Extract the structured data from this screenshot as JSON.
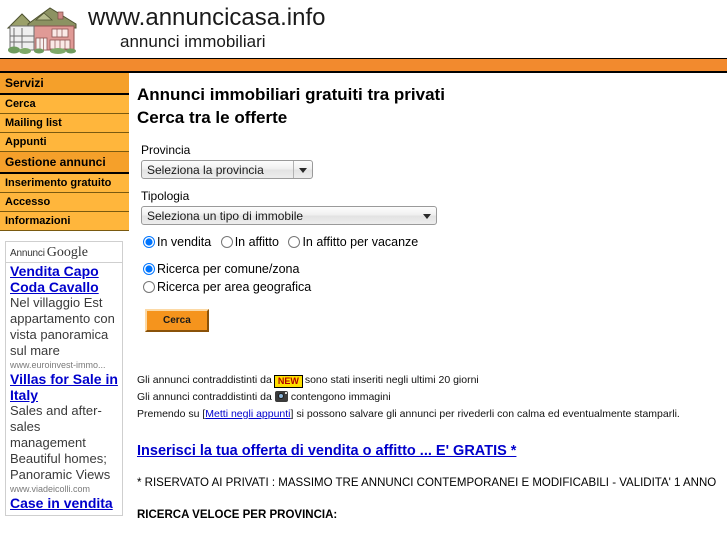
{
  "header": {
    "logo_icon": "house-logo",
    "title": "www.annuncicasa.info",
    "subtitle": "annunci immobiliari",
    "bar_color": "#f28a2e"
  },
  "sidebar": {
    "groups": [
      {
        "heading": "Servizi",
        "items": [
          {
            "label": "Cerca"
          },
          {
            "label": "Mailing list"
          },
          {
            "label": "Appunti"
          }
        ]
      },
      {
        "heading": "Gestione annunci",
        "items": [
          {
            "label": "Inserimento gratuito"
          },
          {
            "label": "Accesso"
          },
          {
            "label": "Informazioni"
          }
        ]
      }
    ],
    "ads": {
      "head_label": "Annunci",
      "head_brand": "Google",
      "units": [
        {
          "title": "Vendita Capo Coda Cavallo",
          "desc": "Nel villaggio Est appartamento con vista panoramica sul mare",
          "url": "www.euroinvest-immo..."
        },
        {
          "title": "Villas for Sale in Italy",
          "desc": "Sales and after-sales management Beautiful homes; Panoramic Views",
          "url": "www.viadeicolli.com"
        },
        {
          "title": "Case in vendita",
          "desc": "",
          "url": ""
        }
      ]
    }
  },
  "main": {
    "title_line1": "Annunci immobiliari gratuiti tra privati",
    "title_line2": "Cerca tra le offerte",
    "provincia_label": "Provincia",
    "provincia_value": "Seleziona la provincia",
    "tipologia_label": "Tipologia",
    "tipologia_value": "Seleziona un tipo di immobile",
    "contract_options": [
      {
        "label": "In vendita",
        "checked": true
      },
      {
        "label": "In affitto",
        "checked": false
      },
      {
        "label": "In affitto per vacanze",
        "checked": false
      }
    ],
    "search_mode_options": [
      {
        "label": "Ricerca per comune/zona",
        "checked": true
      },
      {
        "label": "Ricerca per area geografica",
        "checked": false
      }
    ],
    "submit_label": "Cerca",
    "notes": {
      "line1_pre": "Gli annunci contraddistinti da",
      "new_badge": "NEW",
      "line1_post": "sono stati inseriti negli ultimi 20 giorni",
      "line2_pre": "Gli annunci contraddistinti da",
      "camera_icon": "camera-icon",
      "line2_post": "contengono immagini",
      "line3_pre": "Premendo su  [",
      "line3_link": "Metti negli appunti",
      "line3_post": "]  si possono salvare gli annunci per rivederli con calma ed eventualmente stamparli."
    },
    "insert_link": "Inserisci la tua offerta di vendita o affitto ... E' GRATIS *",
    "disclaimer": "* RISERVATO AI PRIVATI :  MASSIMO TRE ANNUNCI CONTEMPORANEI E MODIFICABILI - VALIDITA' 1 ANNO",
    "ricerca_veloce": "RICERCA VELOCE PER PROVINCIA:"
  }
}
